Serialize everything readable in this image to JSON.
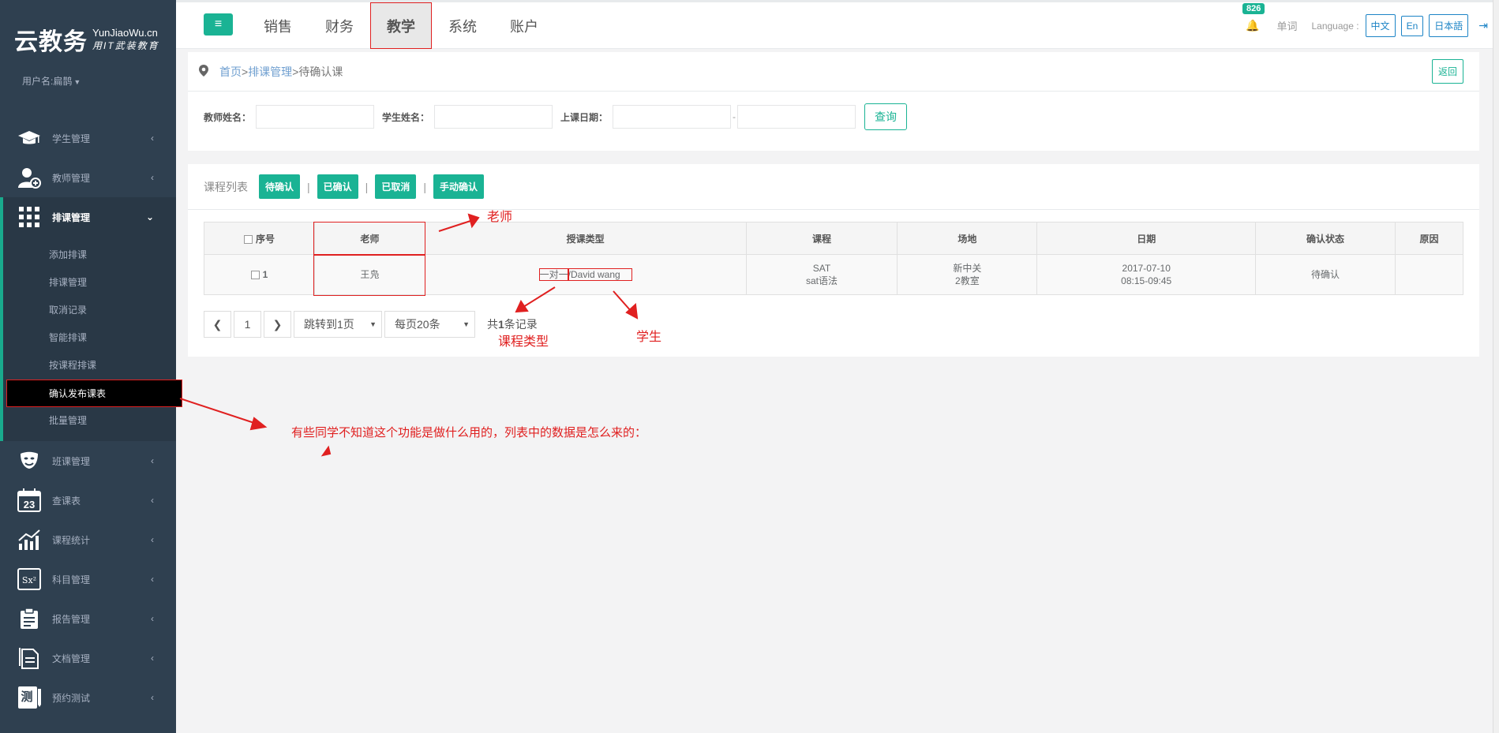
{
  "sidebar": {
    "logo_cn": "云教务",
    "logo_en": "YunJiaoWu.cn",
    "logo_tagline": "用IT武装教育",
    "user_label": "用户名:扁鹊",
    "items": [
      {
        "label": "学生管理",
        "icon": "graduation-cap-icon"
      },
      {
        "label": "教师管理",
        "icon": "teacher-add-icon"
      },
      {
        "label": "排课管理",
        "icon": "grid-icon"
      },
      {
        "label": "班课管理",
        "icon": "theater-mask-icon"
      },
      {
        "label": "查课表",
        "icon": "calendar-icon"
      },
      {
        "label": "课程统计",
        "icon": "chart-icon"
      },
      {
        "label": "科目管理",
        "icon": "subject-icon"
      },
      {
        "label": "报告管理",
        "icon": "clipboard-icon"
      },
      {
        "label": "文档管理",
        "icon": "document-icon"
      },
      {
        "label": "预约测试",
        "icon": "test-icon"
      }
    ],
    "calendar_day": "23",
    "subitems": [
      "添加排课",
      "排课管理",
      "取消记录",
      "智能排课",
      "按课程排课",
      "确认发布课表",
      "批量管理"
    ]
  },
  "topbar": {
    "tabs": [
      "销售",
      "财务",
      "教学",
      "系统",
      "账户"
    ],
    "notification_count": "826",
    "word_link": "单词",
    "language_label": "Language :",
    "languages": [
      "中文",
      "En",
      "日本語"
    ]
  },
  "breadcrumb": {
    "home": "首页",
    "sep": ">",
    "section": "排课管理",
    "current": "待确认课",
    "back": "返回"
  },
  "filters": {
    "teacher_label": "教师姓名：",
    "student_label": "学生姓名：",
    "date_label": "上课日期：",
    "date_sep": "-",
    "query": "查询"
  },
  "list": {
    "title": "课程列表",
    "filter_buttons": [
      "待确认",
      "已确认",
      "已取消",
      "手动确认"
    ],
    "divider": "|",
    "columns": [
      "序号",
      "老师",
      "授课类型",
      "课程",
      "场地",
      "日期",
      "确认状态",
      "原因"
    ],
    "rows": [
      {
        "index": "1",
        "teacher": "王凫",
        "type_prefix": "一对一",
        "type_student": "/David wang",
        "course_line1": "SAT",
        "course_line2": "sat语法",
        "venue_line1": "新中关",
        "venue_line2": "2教室",
        "date_line1": "2017-07-10",
        "date_line2": "08:15-09:45",
        "status": "待确认",
        "reason": ""
      }
    ]
  },
  "pager": {
    "current_page": "1",
    "jump": "跳转到1页",
    "per_page": "每页20条",
    "total_prefix": "共",
    "total_count": "1",
    "total_suffix": "条记录"
  },
  "annotations": {
    "teacher": "老师",
    "course_type": "课程类型",
    "student": "学生",
    "note": "有些同学不知道这个功能是做什么用的，列表中的数据是怎么来的："
  }
}
